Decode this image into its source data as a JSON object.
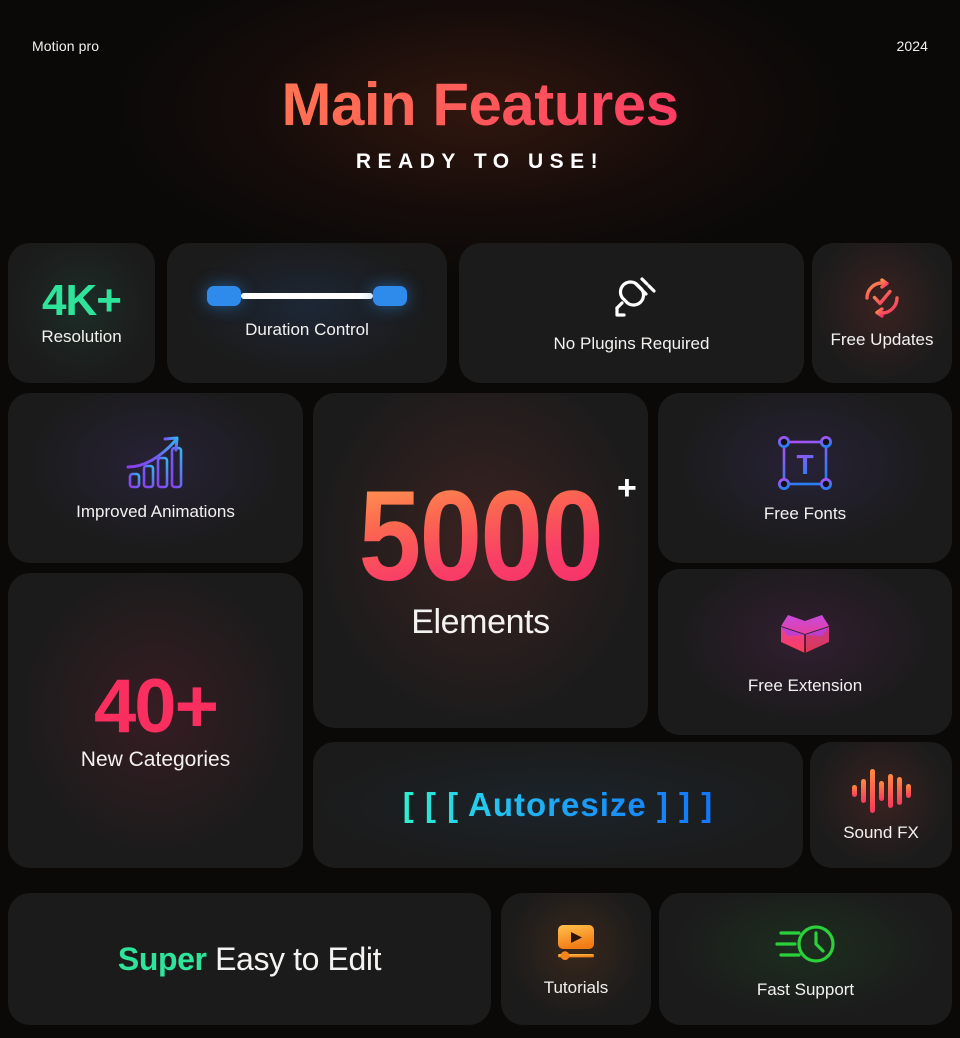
{
  "header": {
    "brand": "Motion pro",
    "year": "2024",
    "title": "Main Features",
    "subtitle": "READY TO USE!"
  },
  "colors": {
    "background": "#0a0908",
    "card": "#1b1b1b",
    "accent_green": "#2fe39a",
    "accent_pink": "#fa2e5f",
    "accent_orange": "#ff9248",
    "accent_blue": "#2e8bec",
    "accent_cyan": "#2ef0d0",
    "accent_violet": "#7b5cf0",
    "accent_magenta": "#d13ad0",
    "accent_lime": "#2bd13a",
    "text_primary": "#f3f1ef"
  },
  "cards": {
    "resolution": {
      "value": "4K+",
      "label": "Resolution"
    },
    "duration": {
      "label": "Duration Control",
      "icon": "range-slider-icon"
    },
    "plugins": {
      "label": "No Plugins Required",
      "icon": "unplugged-plug-icon"
    },
    "updates": {
      "label": "Free Updates",
      "icon": "refresh-check-icon"
    },
    "animations": {
      "label": "Improved Animations",
      "icon": "growth-bar-chart-icon"
    },
    "elements": {
      "value": "5000",
      "plus": "+",
      "label": "Elements"
    },
    "fonts": {
      "label": "Free Fonts",
      "icon": "text-bounding-box-icon"
    },
    "categories": {
      "value": "40+",
      "label": "New Categories"
    },
    "extension": {
      "label": "Free Extension",
      "icon": "open-box-icon"
    },
    "autoresize": {
      "label": "[ [ [ Autoresize ] ] ]"
    },
    "soundfx": {
      "label": "Sound FX",
      "icon": "audio-waveform-icon"
    },
    "easy_edit": {
      "accent": "Super",
      "rest": " Easy to Edit"
    },
    "tutorials": {
      "label": "Tutorials",
      "icon": "video-player-icon"
    },
    "support": {
      "label": "Fast Support",
      "icon": "fast-clock-icon"
    }
  }
}
